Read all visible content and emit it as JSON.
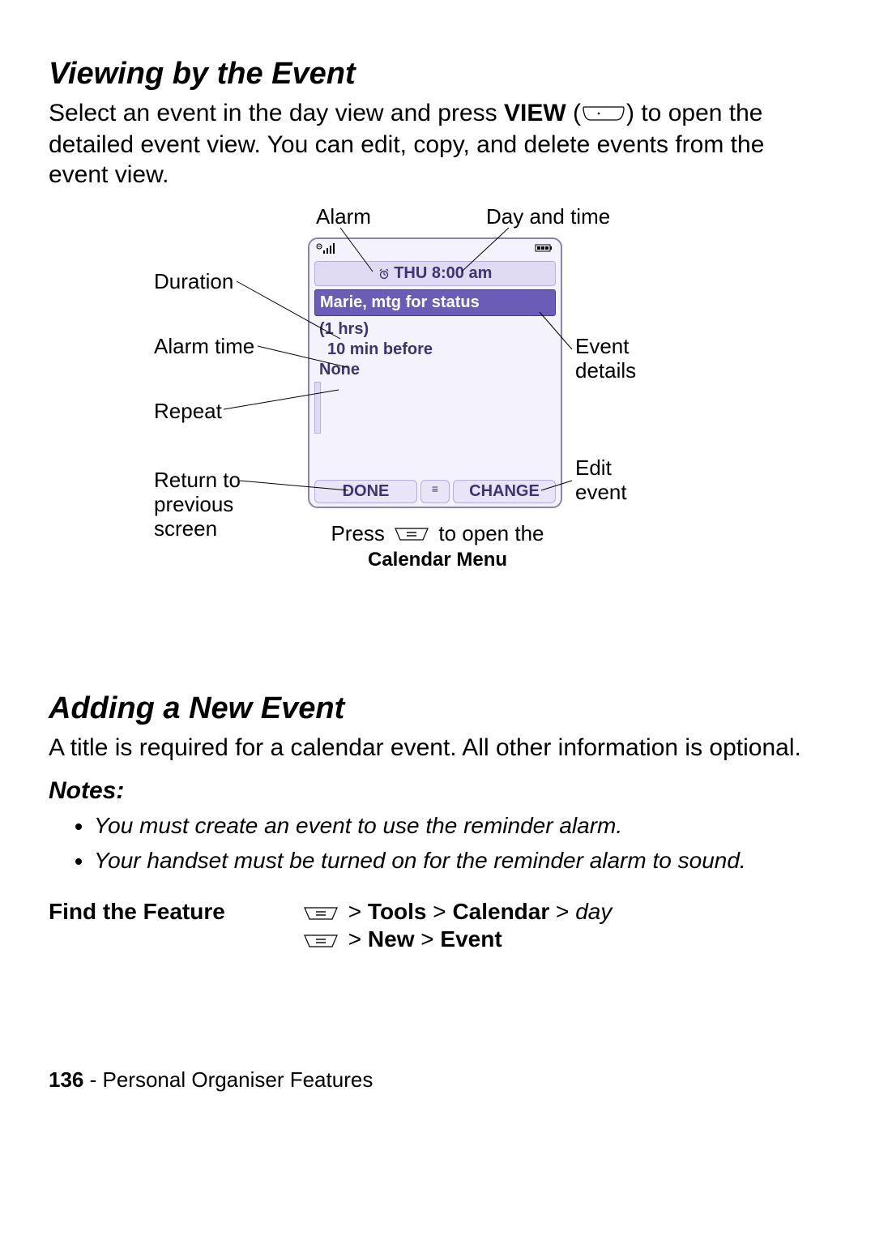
{
  "section1": {
    "heading": "Viewing by the Event",
    "body_pre": "Select an event in the day view and press ",
    "view_word": "VIEW",
    "body_post": " to open the detailed event view. You can edit, copy, and delete events from the event view."
  },
  "diagram": {
    "labels": {
      "alarm": "Alarm",
      "day_time": "Day and time",
      "duration": "Duration",
      "alarm_time": "Alarm time",
      "event_details": "Event\ndetails",
      "repeat": "Repeat",
      "return_prev": "Return to\nprevious\nscreen",
      "edit_event": "Edit\nevent"
    },
    "phone": {
      "title": "THU 8:00 am",
      "event": "Marie, mtg for status",
      "duration": "(1 hrs)",
      "alarm_time": "10 min before",
      "repeat": "None",
      "done": "DONE",
      "change": "CHANGE",
      "menu_glyph": "≡"
    },
    "caption": {
      "pre": "Press ",
      "post": " to open the",
      "menu": "Calendar Menu"
    }
  },
  "section2": {
    "heading": "Adding a New Event",
    "body": "A title is required for a calendar event. All other information is optional.",
    "notes_heading": "Notes:",
    "notes": [
      "You must create an event to use the reminder alarm.",
      "Your handset must be turned on for the reminder alarm to sound."
    ]
  },
  "find_feature": {
    "label": "Find the Feature",
    "path1_tools": "Tools",
    "path1_cal": "Calendar",
    "path1_day": "day",
    "path2_new": "New",
    "path2_event": "Event",
    "gt": " > "
  },
  "footer": {
    "page": "136",
    "sep": " - ",
    "title": "Personal Organiser Features"
  }
}
